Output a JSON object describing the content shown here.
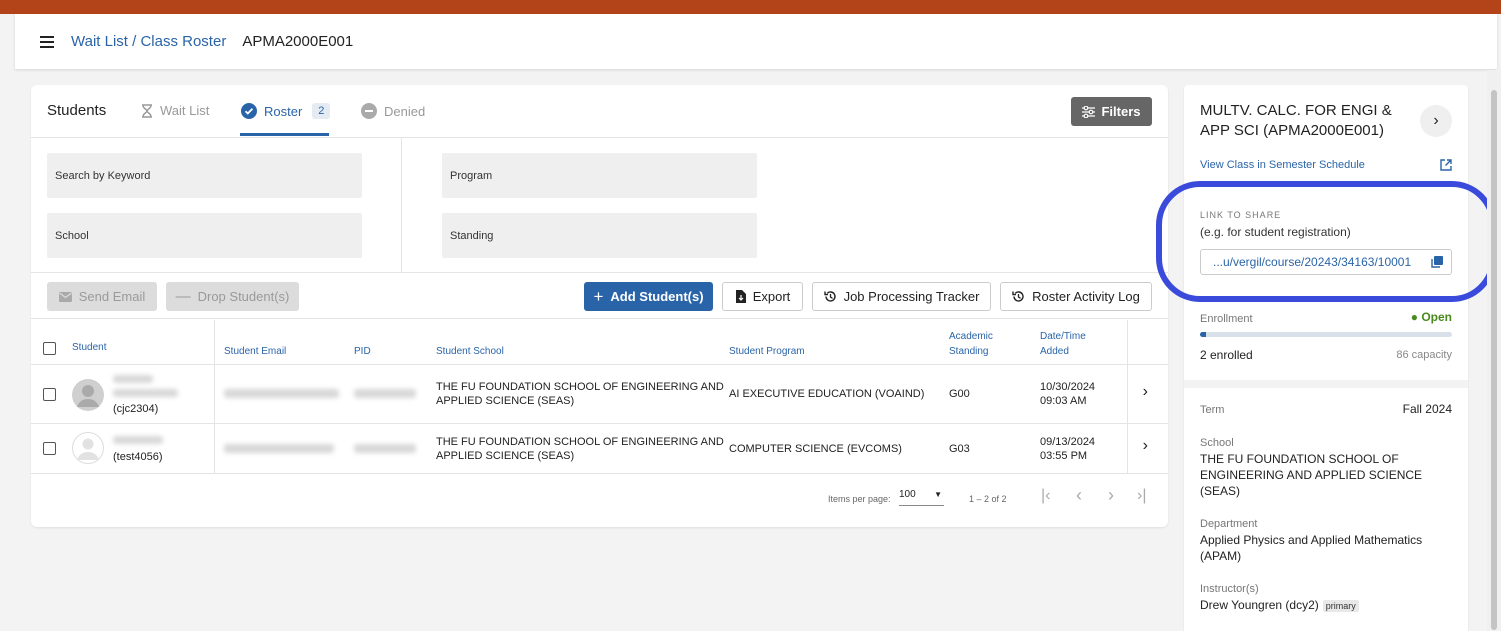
{
  "header": {
    "breadcrumb": "Wait List / Class Roster",
    "course_code": "APMA2000E001"
  },
  "tabs": {
    "title": "Students",
    "wait_list": "Wait List",
    "roster": "Roster",
    "roster_count": "2",
    "denied": "Denied",
    "filters": "Filters"
  },
  "filters": {
    "keyword": "Search by Keyword",
    "program": "Program",
    "school": "School",
    "standing": "Standing"
  },
  "actions": {
    "send_email": "Send Email",
    "drop_students": "Drop Student(s)",
    "add_students": "Add Student(s)",
    "export": "Export",
    "job_tracker": "Job Processing Tracker",
    "activity_log": "Roster Activity Log"
  },
  "table": {
    "headers": {
      "student": "Student",
      "email": "Student Email",
      "pid": "PID",
      "school": "Student School",
      "program": "Student Program",
      "standing_1": "Academic",
      "standing_2": "Standing",
      "date_1": "Date/Time",
      "date_2": "Added"
    },
    "rows": [
      {
        "uni": "(cjc2304)",
        "school_1": "THE FU FOUNDATION SCHOOL OF ENGINEERING AND",
        "school_2": "APPLIED SCIENCE (SEAS)",
        "program": "AI EXECUTIVE EDUCATION (VOAIND)",
        "standing": "G00",
        "date": "10/30/2024",
        "time": "09:03 AM"
      },
      {
        "uni": "(test4056)",
        "school_1": "THE FU FOUNDATION SCHOOL OF ENGINEERING AND",
        "school_2": "APPLIED SCIENCE (SEAS)",
        "program": "COMPUTER SCIENCE (EVCOMS)",
        "standing": "G03",
        "date": "09/13/2024",
        "time": "03:55 PM"
      }
    ]
  },
  "pager": {
    "items_label": "Items per page:",
    "per_page": "100",
    "range": "1 – 2 of 2"
  },
  "side": {
    "title": "MULTV. CALC. FOR ENGI & APP SCI (APMA2000E001)",
    "view_schedule": "View Class in Semester Schedule",
    "share_label": "LINK TO SHARE",
    "share_hint": "(e.g. for student registration)",
    "share_url": "...u/vergil/course/20243/34163/10001",
    "enrollment_label": "Enrollment",
    "enrollment_status": "Open",
    "enrolled_fraction": 0.023,
    "enrolled": "2 enrolled",
    "capacity": "86 capacity",
    "term_label": "Term",
    "term": "Fall 2024",
    "school_label": "School",
    "school": "THE FU FOUNDATION SCHOOL OF ENGINEERING AND APPLIED SCIENCE (SEAS)",
    "dept_label": "Department",
    "dept": "Applied Physics and Applied Mathematics (APAM)",
    "instructor_label": "Instructor(s)",
    "instructor": "Drew Youngren (dcy2)",
    "instructor_tag": "primary"
  },
  "colors": {
    "brand_bar": "#b3441a",
    "accent": "#2a64a8",
    "highlight": "#3a4bdb",
    "open_status": "#4a8a1c"
  }
}
